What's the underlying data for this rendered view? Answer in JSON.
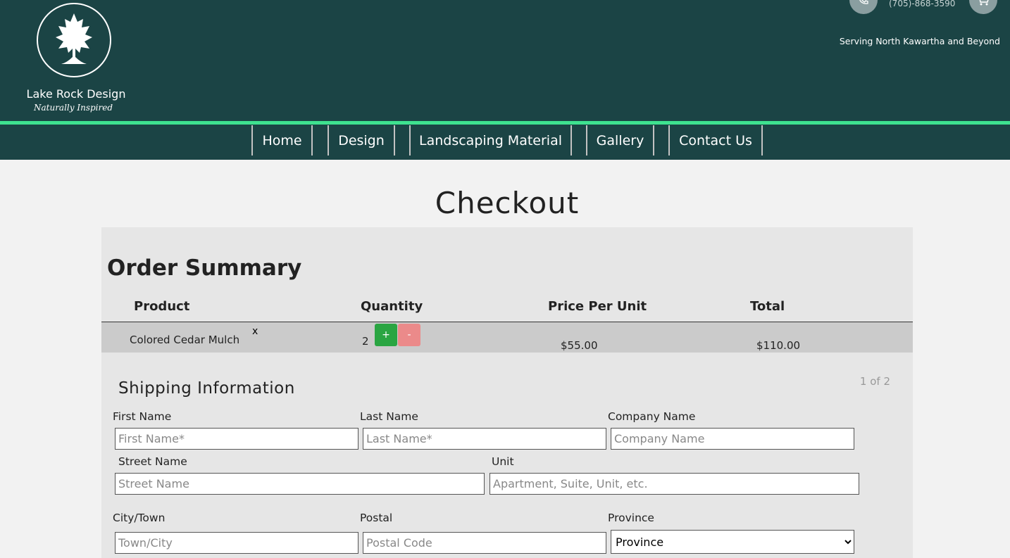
{
  "header": {
    "brand_name": "Lake Rock Design",
    "brand_tagline": "Naturally Inspired",
    "phone": "(705)-868-3590",
    "serving": "Serving North Kawartha and Beyond"
  },
  "nav": {
    "items": [
      {
        "label": "Home"
      },
      {
        "label": "Design"
      },
      {
        "label": "Landscaping Material"
      },
      {
        "label": "Gallery"
      },
      {
        "label": "Contact Us"
      }
    ]
  },
  "page": {
    "title": "Checkout"
  },
  "order_summary": {
    "title": "Order Summary",
    "columns": [
      "Product",
      "Quantity",
      "Price Per Unit",
      "Total"
    ],
    "rows": [
      {
        "product": "Colored Cedar Mulch",
        "remove": "x",
        "quantity": "2",
        "plus": "+",
        "minus": "-",
        "price": "$55.00",
        "total": "$110.00"
      }
    ]
  },
  "shipping": {
    "title": "Shipping Information",
    "step": "1 of 2",
    "fields": {
      "first_name": {
        "label": "First Name",
        "placeholder": "First Name*",
        "value": ""
      },
      "last_name": {
        "label": "Last Name",
        "placeholder": "Last Name*",
        "value": ""
      },
      "company": {
        "label": "Company Name",
        "placeholder": "Company Name",
        "value": ""
      },
      "street": {
        "label": "Street Name",
        "placeholder": "Street Name",
        "value": ""
      },
      "unit": {
        "label": "Unit",
        "placeholder": "Apartment, Suite, Unit, etc.",
        "value": ""
      },
      "city": {
        "label": "City/Town",
        "placeholder": "Town/City",
        "value": ""
      },
      "postal": {
        "label": "Postal",
        "placeholder": "Postal Code",
        "value": ""
      },
      "province": {
        "label": "Province",
        "selected": "Province"
      }
    }
  },
  "colors": {
    "header_bg": "#1b4445",
    "accent": "#3ee28f",
    "plus_button": "#2aa542",
    "minus_button": "#eb8a8a"
  },
  "icons": {
    "logo": "tree-icon",
    "phone": "phone-icon",
    "cart": "cart-icon"
  }
}
